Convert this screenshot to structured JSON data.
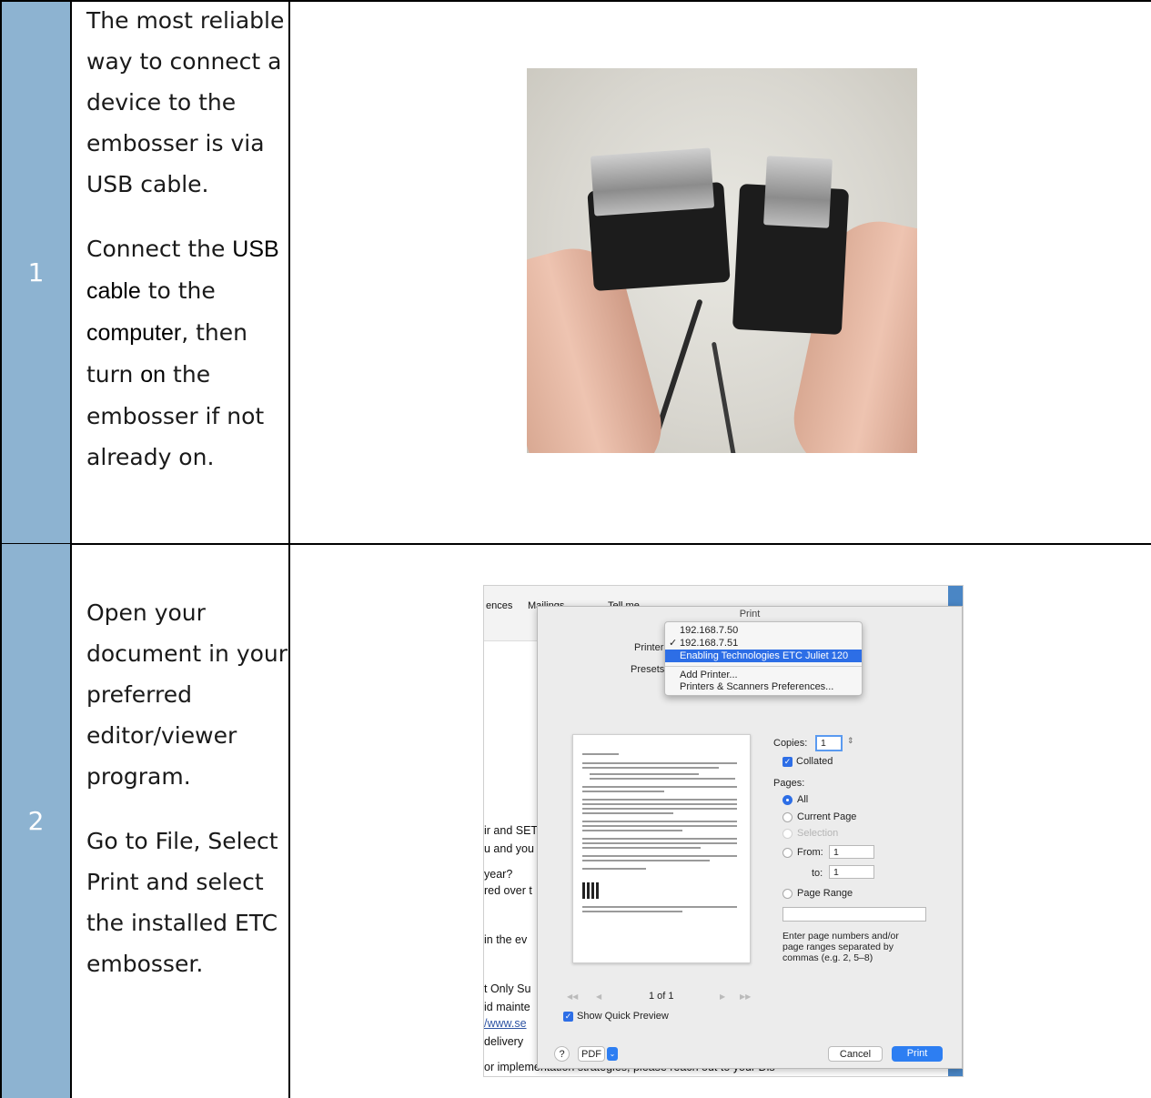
{
  "rows": [
    {
      "number": "1",
      "para1": "The most reliable way to connect a device to the embosser is via USB cable.",
      "para2_parts": [
        "Connect the ",
        "USB cable",
        " to the ",
        "computer",
        ", then turn ",
        "on",
        " the embosser if not already on."
      ]
    },
    {
      "number": "2",
      "para1": "Open your document in your preferred editor/viewer program.",
      "para2": "Go to File, Select Print and select the installed ETC embosser."
    }
  ],
  "print_dialog": {
    "title": "Print",
    "printer_label": "Printer",
    "presets_label": "Presets",
    "printer_menu": {
      "items": [
        "192.168.7.50",
        "192.168.7.51",
        "Enabling Technologies ETC Juliet 120",
        "Add Printer...",
        "Printers & Scanners Preferences..."
      ],
      "checkmark": "✓"
    },
    "copies_label": "Copies:",
    "copies_value": "1",
    "collated_label": "Collated",
    "pages_label": "Pages:",
    "page_options": [
      "All",
      "Current Page",
      "Selection",
      "From:",
      "to:",
      "Page Range"
    ],
    "from_value": "1",
    "to_value": "1",
    "page_hint": "Enter page numbers and/or page ranges separated by commas (e.g. 2, 5–8)",
    "page_counter": "1 of 1",
    "show_quick_preview": "Show Quick Preview",
    "help": "?",
    "pdf": "PDF",
    "cancel": "Cancel",
    "print": "Print"
  },
  "word_background": {
    "ribbon_tabs": [
      "ences",
      "Mailings"
    ],
    "tell_me": "Tell me",
    "fragments": [
      "ir and SET",
      "u and you",
      "year?",
      "red over t",
      "in the ev",
      "t Only Su",
      "id mainte",
      "/www.se",
      "delivery",
      "or implementation strategies, please reach out to your Dis"
    ]
  }
}
